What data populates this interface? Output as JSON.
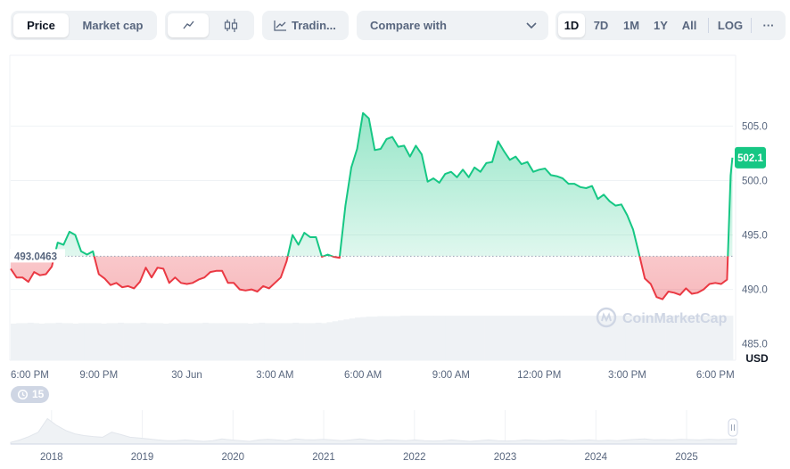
{
  "toolbar": {
    "price_label": "Price",
    "market_cap_label": "Market cap",
    "line_icon": "line-chart-icon",
    "candle_icon": "candlestick-icon",
    "trading_label": "Tradin...",
    "compare_label": "Compare with",
    "ranges": [
      "1D",
      "7D",
      "1M",
      "1Y",
      "All",
      "LOG"
    ],
    "active_range": "1D",
    "more_label": "···"
  },
  "watermark": "CoinMarketCap",
  "restore_count": "15",
  "colors": {
    "up": "#16c784",
    "down": "#ea3943",
    "grid": "#eff2f5"
  },
  "chart_data": {
    "type": "line",
    "unit_label": "USD",
    "baseline": 493.0463,
    "baseline_label": "493.0463",
    "current_label": "502.1",
    "y_ticks": [
      485.0,
      490.0,
      495.0,
      500.0,
      505.0
    ],
    "y_tick_labels": [
      "485.0",
      "490.0",
      "495.0",
      "500.0",
      "505.0"
    ],
    "ylim": [
      483.5,
      511.5
    ],
    "x_ticks": [
      0,
      3,
      6,
      9,
      12,
      15,
      18,
      21,
      24
    ],
    "x_tick_labels": [
      "6:00 PM",
      "9:00 PM",
      "30 Jun",
      "3:00 AM",
      "6:00 AM",
      "9:00 AM",
      "12:00 PM",
      "3:00 PM",
      "6:00 PM"
    ],
    "xlim": [
      0,
      24.6
    ],
    "x": [
      0.0,
      0.2,
      0.4,
      0.6,
      0.8,
      1.0,
      1.2,
      1.4,
      1.6,
      1.8,
      2.0,
      2.2,
      2.4,
      2.6,
      2.8,
      3.0,
      3.2,
      3.4,
      3.6,
      3.8,
      4.0,
      4.2,
      4.4,
      4.6,
      4.8,
      5.0,
      5.2,
      5.4,
      5.6,
      5.8,
      6.0,
      6.2,
      6.4,
      6.6,
      6.8,
      7.0,
      7.2,
      7.4,
      7.6,
      7.8,
      8.0,
      8.2,
      8.4,
      8.6,
      8.8,
      9.0,
      9.2,
      9.4,
      9.6,
      9.8,
      10.0,
      10.2,
      10.4,
      10.6,
      10.8,
      11.0,
      11.2,
      11.4,
      11.6,
      11.8,
      12.0,
      12.2,
      12.4,
      12.6,
      12.8,
      13.0,
      13.2,
      13.4,
      13.6,
      13.8,
      14.0,
      14.2,
      14.4,
      14.6,
      14.8,
      15.0,
      15.2,
      15.4,
      15.6,
      15.8,
      16.0,
      16.2,
      16.4,
      16.6,
      16.8,
      17.0,
      17.2,
      17.4,
      17.6,
      17.8,
      18.0,
      18.2,
      18.4,
      18.6,
      18.8,
      19.0,
      19.2,
      19.4,
      19.6,
      19.8,
      20.0,
      20.2,
      20.4,
      20.6,
      20.8,
      21.0,
      21.2,
      21.4,
      21.6,
      21.8,
      22.0,
      22.2,
      22.4,
      22.6,
      22.8,
      23.0,
      23.2,
      23.4,
      23.6,
      23.8,
      24.0,
      24.2,
      24.4
    ],
    "values": [
      491.9,
      491.1,
      491.1,
      490.7,
      491.6,
      491.3,
      491.4,
      492.1,
      494.3,
      494.1,
      495.3,
      495.0,
      493.5,
      493.2,
      493.5,
      491.4,
      491.0,
      490.4,
      490.6,
      490.2,
      490.3,
      490.1,
      490.7,
      492.0,
      491.1,
      492.0,
      491.9,
      490.6,
      491.1,
      490.6,
      490.5,
      490.6,
      490.9,
      491.1,
      491.6,
      491.7,
      491.7,
      490.6,
      490.6,
      490.0,
      489.9,
      490.0,
      489.8,
      490.3,
      490.1,
      490.6,
      491.1,
      492.6,
      495.0,
      494.1,
      495.2,
      494.8,
      494.8,
      493.0,
      493.2,
      493.0,
      492.9,
      497.7,
      501.2,
      502.9,
      506.2,
      505.7,
      502.8,
      502.9,
      503.8,
      504.0,
      503.1,
      503.2,
      502.2,
      503.2,
      502.4,
      499.9,
      500.2,
      499.8,
      500.6,
      500.8,
      500.3,
      501.0,
      500.3,
      501.2,
      500.8,
      501.6,
      501.7,
      503.6,
      502.7,
      501.9,
      502.2,
      501.5,
      501.7,
      500.8,
      501.0,
      501.1,
      500.5,
      500.4,
      500.2,
      499.7,
      499.7,
      499.4,
      499.3,
      499.5,
      498.3,
      498.7,
      498.1,
      497.7,
      497.8,
      496.8,
      495.5,
      493.3,
      491.0,
      490.5,
      489.3,
      489.1,
      489.8,
      489.7,
      489.5,
      490.1,
      489.6,
      489.7,
      490.0,
      490.5,
      490.6,
      490.5,
      490.9,
      491.6,
      491.7,
      491.1,
      491.4,
      490.4
    ],
    "volume_level": [
      0.79,
      0.8,
      0.8,
      0.81,
      0.8,
      0.79,
      0.8,
      0.8,
      0.81,
      0.8,
      0.8,
      0.79,
      0.8,
      0.8,
      0.8,
      0.8,
      0.79,
      0.8,
      0.8,
      0.81,
      0.8,
      0.8,
      0.8,
      0.81,
      0.8,
      0.8,
      0.8,
      0.79,
      0.8,
      0.8,
      0.8,
      0.8,
      0.8,
      0.8,
      0.81,
      0.8,
      0.8,
      0.8,
      0.8,
      0.8,
      0.8,
      0.8,
      0.79,
      0.8,
      0.81,
      0.8,
      0.8,
      0.8,
      0.8,
      0.8,
      0.81,
      0.8,
      0.8,
      0.8,
      0.81,
      0.8,
      0.82,
      0.84,
      0.86,
      0.88,
      0.9,
      0.92,
      0.93,
      0.94,
      0.94,
      0.95,
      0.95,
      0.95,
      0.95,
      0.96,
      0.96,
      0.96,
      0.96,
      0.96,
      0.96,
      0.96,
      0.96,
      0.96,
      0.96,
      0.96,
      0.96,
      0.96,
      0.96,
      0.96,
      0.96,
      0.96,
      0.96,
      0.96,
      0.96,
      0.96,
      0.96,
      0.96,
      0.96,
      0.96,
      0.96,
      0.96,
      0.96,
      0.96,
      0.96,
      0.96,
      0.96,
      0.96,
      0.96,
      0.96,
      0.96,
      0.96,
      0.96,
      0.96,
      0.96,
      0.96,
      0.96,
      0.96,
      0.96,
      0.96,
      0.96,
      0.96,
      0.96,
      0.96,
      0.96,
      0.96,
      0.96,
      0.96,
      0.96,
      0.96,
      0.96,
      0.96,
      0.96,
      0.96
    ],
    "navigator": {
      "x_tick_labels": [
        "2018",
        "2019",
        "2020",
        "2021",
        "2022",
        "2023",
        "2024",
        "2025"
      ],
      "years": [
        2018,
        2019,
        2020,
        2021,
        2022,
        2023,
        2024,
        2025
      ],
      "xlim": [
        2017.55,
        2025.55
      ],
      "shape": [
        0.05,
        0.12,
        0.22,
        0.35,
        0.75,
        0.55,
        0.4,
        0.3,
        0.25,
        0.22,
        0.2,
        0.35,
        0.28,
        0.2,
        0.18,
        0.15,
        0.12,
        0.1,
        0.1,
        0.12,
        0.1,
        0.08,
        0.1,
        0.15,
        0.12,
        0.1,
        0.08,
        0.12,
        0.14,
        0.12,
        0.1,
        0.15,
        0.13,
        0.12,
        0.14,
        0.12,
        0.1,
        0.12,
        0.15,
        0.12,
        0.1,
        0.12,
        0.11,
        0.1,
        0.12,
        0.1,
        0.09,
        0.1,
        0.12,
        0.1,
        0.08,
        0.1,
        0.12,
        0.1,
        0.09,
        0.1,
        0.12,
        0.11,
        0.1,
        0.11,
        0.12,
        0.1,
        0.11,
        0.12,
        0.1,
        0.11,
        0.1,
        0.12,
        0.14,
        0.15,
        0.12,
        0.13,
        0.12,
        0.14,
        0.13,
        0.12,
        0.14,
        0.13,
        0.14,
        0.15
      ]
    }
  }
}
